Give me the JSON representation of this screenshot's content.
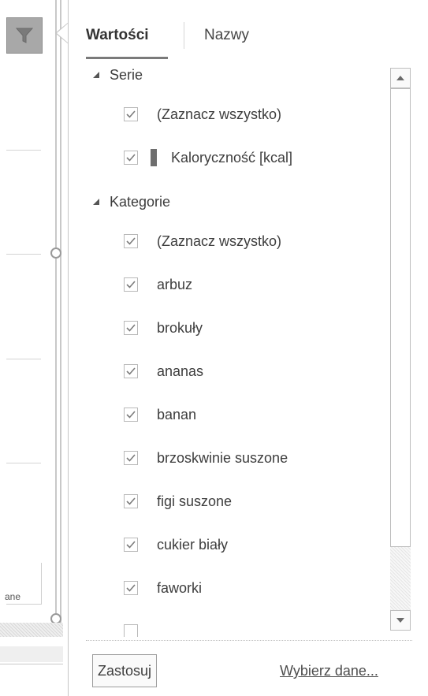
{
  "chart_background": {
    "axis_text": "ane"
  },
  "tabs": [
    {
      "label": "Wartości",
      "active": true
    },
    {
      "label": "Nazwy",
      "active": false
    }
  ],
  "series_group": {
    "label": "Serie",
    "expanded": true,
    "items": [
      {
        "label": "(Zaznacz wszystko)",
        "checked": true
      },
      {
        "label": "Kaloryczność [kcal]",
        "checked": true,
        "swatch_color": "#6e6e6e"
      }
    ]
  },
  "category_group": {
    "label": "Kategorie",
    "expanded": true,
    "items": [
      {
        "label": "(Zaznacz wszystko)",
        "checked": true
      },
      {
        "label": "arbuz",
        "checked": true
      },
      {
        "label": "brokuły",
        "checked": true
      },
      {
        "label": "ananas",
        "checked": true
      },
      {
        "label": "banan",
        "checked": true
      },
      {
        "label": "brzoskwinie suszone",
        "checked": true
      },
      {
        "label": "figi suszone",
        "checked": true
      },
      {
        "label": "cukier biały",
        "checked": true
      },
      {
        "label": "faworki",
        "checked": true
      }
    ]
  },
  "footer": {
    "apply_label": "Zastosuj",
    "select_data_label": "Wybierz dane..."
  },
  "icons": {
    "filter": "funnel-icon",
    "expand": "triangle-expanded-icon",
    "check": "checkmark-icon",
    "scroll_up": "scroll-up-arrow-icon",
    "scroll_down": "scroll-down-arrow-icon"
  },
  "colors": {
    "filter_button": "#a8a8a8",
    "panel_border": "#c6c6c6",
    "checkbox_border": "#b9b9b9",
    "check_mark": "#7c7c7c"
  }
}
